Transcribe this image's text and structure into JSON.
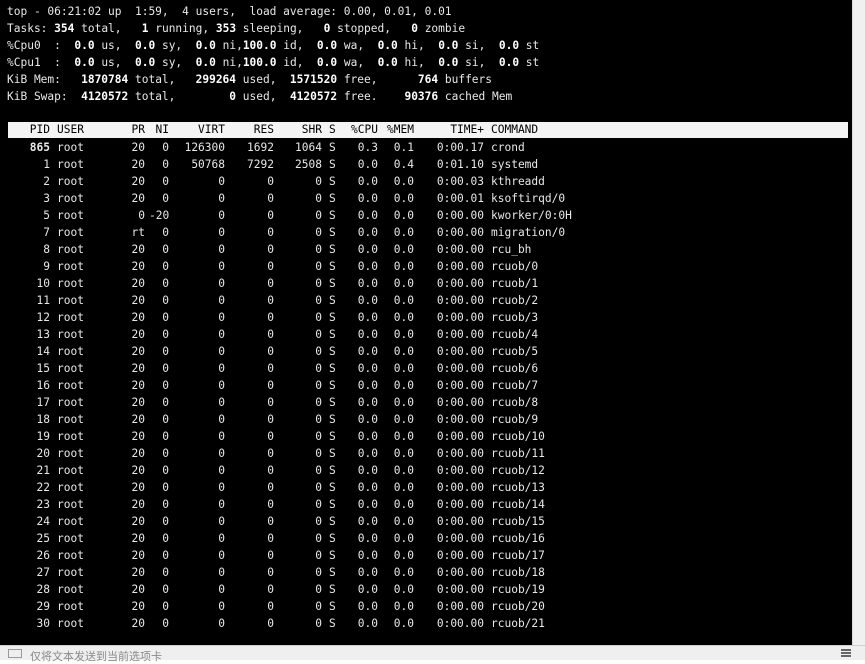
{
  "summary": {
    "line1": "top - 06:21:02 up  1:59,  4 users,  load average: 0.00, 0.01, 0.01",
    "tasks": [
      "Tasks: ",
      "354",
      " total,   ",
      "1",
      " running, ",
      "353",
      " sleeping,   ",
      "0",
      " stopped,   ",
      "0",
      " zombie"
    ],
    "cpu0": [
      "%Cpu0  :  ",
      "0.0",
      " us,  ",
      "0.0",
      " sy,  ",
      "0.0",
      " ni,",
      "100.0",
      " id,  ",
      "0.0",
      " wa,  ",
      "0.0",
      " hi,  ",
      "0.0",
      " si,  ",
      "0.0",
      " st"
    ],
    "cpu1": [
      "%Cpu1  :  ",
      "0.0",
      " us,  ",
      "0.0",
      " sy,  ",
      "0.0",
      " ni,",
      "100.0",
      " id,  ",
      "0.0",
      " wa,  ",
      "0.0",
      " hi,  ",
      "0.0",
      " si,  ",
      "0.0",
      " st"
    ],
    "mem": [
      "KiB Mem:   ",
      "1870784",
      " total,   ",
      "299264",
      " used,  ",
      "1571520",
      " free,      ",
      "764",
      " buffers"
    ],
    "swap": [
      "KiB Swap:  ",
      "4120572",
      " total,        ",
      "0",
      " used,  ",
      "4120572",
      " free.    ",
      "90376",
      " cached Mem"
    ]
  },
  "columns": [
    "PID",
    "USER",
    "PR",
    "NI",
    "VIRT",
    "RES",
    "SHR",
    "S",
    "%CPU",
    "%MEM",
    "TIME+",
    "COMMAND"
  ],
  "processes": [
    [
      "865",
      "root",
      "20",
      "0",
      "126300",
      "1692",
      "1064",
      "S",
      "0.3",
      "0.1",
      "0:00.17",
      "crond"
    ],
    [
      "1",
      "root",
      "20",
      "0",
      "50768",
      "7292",
      "2508",
      "S",
      "0.0",
      "0.4",
      "0:01.10",
      "systemd"
    ],
    [
      "2",
      "root",
      "20",
      "0",
      "0",
      "0",
      "0",
      "S",
      "0.0",
      "0.0",
      "0:00.03",
      "kthreadd"
    ],
    [
      "3",
      "root",
      "20",
      "0",
      "0",
      "0",
      "0",
      "S",
      "0.0",
      "0.0",
      "0:00.01",
      "ksoftirqd/0"
    ],
    [
      "5",
      "root",
      "0",
      "-20",
      "0",
      "0",
      "0",
      "S",
      "0.0",
      "0.0",
      "0:00.00",
      "kworker/0:0H"
    ],
    [
      "7",
      "root",
      "rt",
      "0",
      "0",
      "0",
      "0",
      "S",
      "0.0",
      "0.0",
      "0:00.00",
      "migration/0"
    ],
    [
      "8",
      "root",
      "20",
      "0",
      "0",
      "0",
      "0",
      "S",
      "0.0",
      "0.0",
      "0:00.00",
      "rcu_bh"
    ],
    [
      "9",
      "root",
      "20",
      "0",
      "0",
      "0",
      "0",
      "S",
      "0.0",
      "0.0",
      "0:00.00",
      "rcuob/0"
    ],
    [
      "10",
      "root",
      "20",
      "0",
      "0",
      "0",
      "0",
      "S",
      "0.0",
      "0.0",
      "0:00.00",
      "rcuob/1"
    ],
    [
      "11",
      "root",
      "20",
      "0",
      "0",
      "0",
      "0",
      "S",
      "0.0",
      "0.0",
      "0:00.00",
      "rcuob/2"
    ],
    [
      "12",
      "root",
      "20",
      "0",
      "0",
      "0",
      "0",
      "S",
      "0.0",
      "0.0",
      "0:00.00",
      "rcuob/3"
    ],
    [
      "13",
      "root",
      "20",
      "0",
      "0",
      "0",
      "0",
      "S",
      "0.0",
      "0.0",
      "0:00.00",
      "rcuob/4"
    ],
    [
      "14",
      "root",
      "20",
      "0",
      "0",
      "0",
      "0",
      "S",
      "0.0",
      "0.0",
      "0:00.00",
      "rcuob/5"
    ],
    [
      "15",
      "root",
      "20",
      "0",
      "0",
      "0",
      "0",
      "S",
      "0.0",
      "0.0",
      "0:00.00",
      "rcuob/6"
    ],
    [
      "16",
      "root",
      "20",
      "0",
      "0",
      "0",
      "0",
      "S",
      "0.0",
      "0.0",
      "0:00.00",
      "rcuob/7"
    ],
    [
      "17",
      "root",
      "20",
      "0",
      "0",
      "0",
      "0",
      "S",
      "0.0",
      "0.0",
      "0:00.00",
      "rcuob/8"
    ],
    [
      "18",
      "root",
      "20",
      "0",
      "0",
      "0",
      "0",
      "S",
      "0.0",
      "0.0",
      "0:00.00",
      "rcuob/9"
    ],
    [
      "19",
      "root",
      "20",
      "0",
      "0",
      "0",
      "0",
      "S",
      "0.0",
      "0.0",
      "0:00.00",
      "rcuob/10"
    ],
    [
      "20",
      "root",
      "20",
      "0",
      "0",
      "0",
      "0",
      "S",
      "0.0",
      "0.0",
      "0:00.00",
      "rcuob/11"
    ],
    [
      "21",
      "root",
      "20",
      "0",
      "0",
      "0",
      "0",
      "S",
      "0.0",
      "0.0",
      "0:00.00",
      "rcuob/12"
    ],
    [
      "22",
      "root",
      "20",
      "0",
      "0",
      "0",
      "0",
      "S",
      "0.0",
      "0.0",
      "0:00.00",
      "rcuob/13"
    ],
    [
      "23",
      "root",
      "20",
      "0",
      "0",
      "0",
      "0",
      "S",
      "0.0",
      "0.0",
      "0:00.00",
      "rcuob/14"
    ],
    [
      "24",
      "root",
      "20",
      "0",
      "0",
      "0",
      "0",
      "S",
      "0.0",
      "0.0",
      "0:00.00",
      "rcuob/15"
    ],
    [
      "25",
      "root",
      "20",
      "0",
      "0",
      "0",
      "0",
      "S",
      "0.0",
      "0.0",
      "0:00.00",
      "rcuob/16"
    ],
    [
      "26",
      "root",
      "20",
      "0",
      "0",
      "0",
      "0",
      "S",
      "0.0",
      "0.0",
      "0:00.00",
      "rcuob/17"
    ],
    [
      "27",
      "root",
      "20",
      "0",
      "0",
      "0",
      "0",
      "S",
      "0.0",
      "0.0",
      "0:00.00",
      "rcuob/18"
    ],
    [
      "28",
      "root",
      "20",
      "0",
      "0",
      "0",
      "0",
      "S",
      "0.0",
      "0.0",
      "0:00.00",
      "rcuob/19"
    ],
    [
      "29",
      "root",
      "20",
      "0",
      "0",
      "0",
      "0",
      "S",
      "0.0",
      "0.0",
      "0:00.00",
      "rcuob/20"
    ],
    [
      "30",
      "root",
      "20",
      "0",
      "0",
      "0",
      "0",
      "S",
      "0.0",
      "0.0",
      "0:00.00",
      "rcuob/21"
    ]
  ],
  "statusbar": {
    "text": "仅将文本发送到当前选项卡",
    "input_icon": "keyboard-icon",
    "menu_icon": "menu-icon"
  }
}
